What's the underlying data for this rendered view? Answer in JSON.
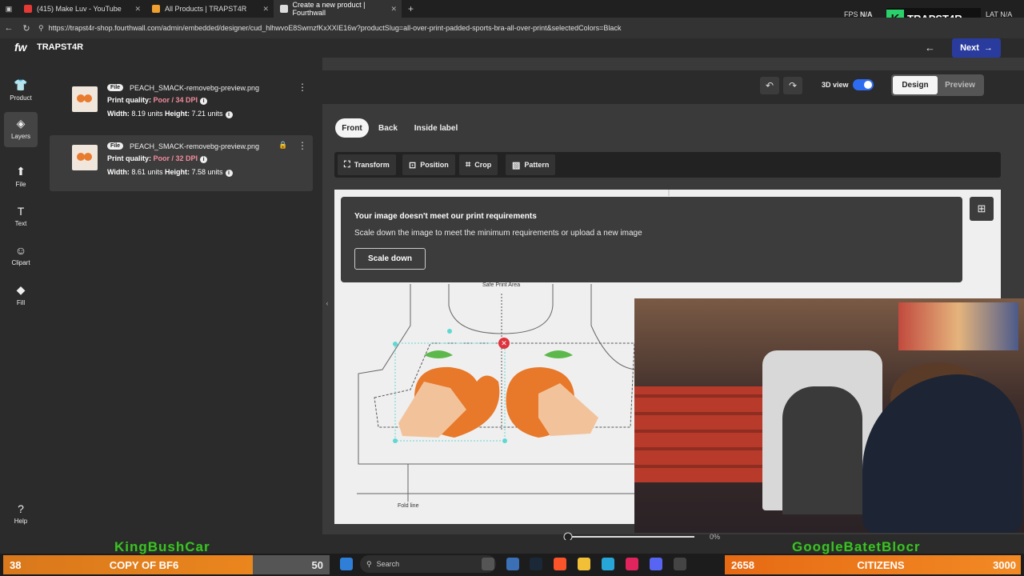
{
  "browser": {
    "tabs": [
      {
        "label": "(415) Make Luv - YouTube",
        "favicon_color": "#e53935"
      },
      {
        "label": "All Products | TRAPST4R",
        "favicon_color": "#f0a030"
      },
      {
        "label": "Create a new product | Fourthwall",
        "favicon_color": "#dddddd"
      }
    ],
    "url": "https://trapst4r-shop.fourthwall.com/admin/embedded/designer/cud_hlhwvoE8SwmzfKxXXIE16w?productSlug=all-over-print-padded-sports-bra-all-over-print&selectedColors=Black"
  },
  "overlay": {
    "fps_label": "FPS",
    "fps_value": "N/A",
    "brand": "TRAPST4R",
    "brand_icon": "K",
    "lat": "LAT",
    "lat_value": "N/A"
  },
  "app": {
    "logo": "fw",
    "store_name": "TRAPST4R",
    "next_label": "Next"
  },
  "rail": [
    {
      "label": "Product",
      "icon": "shirt-icon"
    },
    {
      "label": "Layers",
      "icon": "layers-icon"
    },
    {
      "label": "File",
      "icon": "upload-icon"
    },
    {
      "label": "Text",
      "icon": "text-icon"
    },
    {
      "label": "Clipart",
      "icon": "smile-icon"
    },
    {
      "label": "Fill",
      "icon": "bucket-icon"
    },
    {
      "label": "Help",
      "icon": "help-icon"
    }
  ],
  "layers": [
    {
      "tag": "File",
      "filename": "PEACH_SMACK-removebg-preview.png",
      "quality_label": "Print quality:",
      "quality_value": "Poor / 34 DPI",
      "width_label": "Width:",
      "width_value": "8.19 units",
      "height_label": "Height:",
      "height_value": "7.21 units"
    },
    {
      "tag": "File",
      "filename": "PEACH_SMACK-removebg-preview.png",
      "quality_label": "Print quality:",
      "quality_value": "Poor / 32 DPI",
      "width_label": "Width:",
      "width_value": "8.61 units",
      "height_label": "Height:",
      "height_value": "7.58 units"
    }
  ],
  "designer": {
    "view3d_label": "3D view",
    "view3d_on": true,
    "mode_tabs": [
      "Design",
      "Preview"
    ],
    "side_tabs": [
      "Front",
      "Back",
      "Inside label"
    ],
    "tools": [
      "Transform",
      "Position",
      "Crop",
      "Pattern"
    ],
    "alert": {
      "title": "Your image doesn't meet our print requirements",
      "body": "Scale down the image to meet the minimum requirements or upload a new image",
      "button": "Scale down"
    },
    "canvas_labels": {
      "safe_area": "Safe Print Area",
      "fold": "Fold line"
    },
    "zoom": "0%"
  },
  "stream_bars": {
    "left": {
      "count": "38",
      "title": "COPY OF BF6",
      "value": "50",
      "name": "KingBushCar"
    },
    "right": {
      "count": "2658",
      "title": "CITIZENS",
      "value": "3000",
      "name": "GoogleBatetBlocr"
    }
  },
  "taskbar": {
    "search_placeholder": "Search"
  }
}
